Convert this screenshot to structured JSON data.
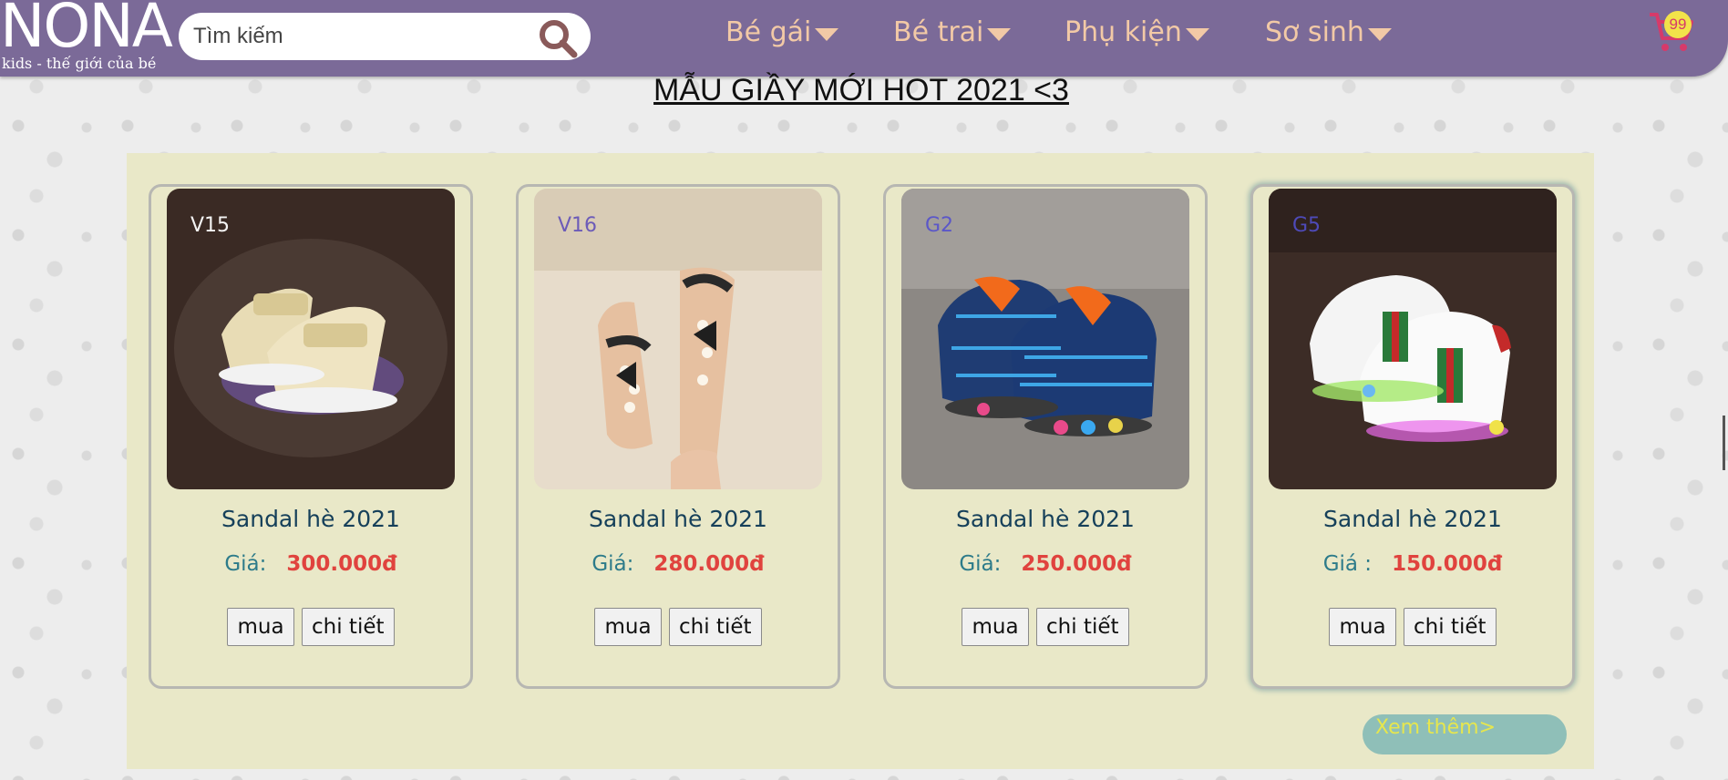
{
  "header": {
    "logo_text": "NONA",
    "logo_tagline": "kids - thế giới của bé",
    "search_placeholder": "Tìm kiếm",
    "nav": [
      {
        "label": "Bé gái"
      },
      {
        "label": "Bé trai"
      },
      {
        "label": "Phụ kiện"
      },
      {
        "label": "Sơ sinh"
      }
    ],
    "cart_count": "99"
  },
  "section": {
    "title": "MẪU GIẦY MỚI HOT 2021 <3"
  },
  "products": [
    {
      "code": "V15",
      "name": "Sandal hè 2021",
      "price_label": "Giá:",
      "price": "300.000đ",
      "buy": "mua",
      "detail": "chi tiết"
    },
    {
      "code": "V16",
      "name": "Sandal hè 2021",
      "price_label": "Giá:",
      "price": "280.000đ",
      "buy": "mua",
      "detail": "chi tiết"
    },
    {
      "code": "G2",
      "name": "Sandal hè 2021",
      "price_label": "Giá:",
      "price": "250.000đ",
      "buy": "mua",
      "detail": "chi tiết"
    },
    {
      "code": "G5",
      "name": "Sandal hè 2021",
      "price_label": "Giá :",
      "price": "150.000đ",
      "buy": "mua",
      "detail": "chi tiết"
    }
  ],
  "more_link": "Xem thêm>",
  "colors": {
    "header_bg": "#7b6a98",
    "nav_text": "#f2c9a6",
    "panel_bg": "#e9e8c8",
    "price": "#e0433e",
    "price_label": "#2d7b8a",
    "more_bg": "#8fbfb8",
    "more_text": "#e6e64e"
  }
}
